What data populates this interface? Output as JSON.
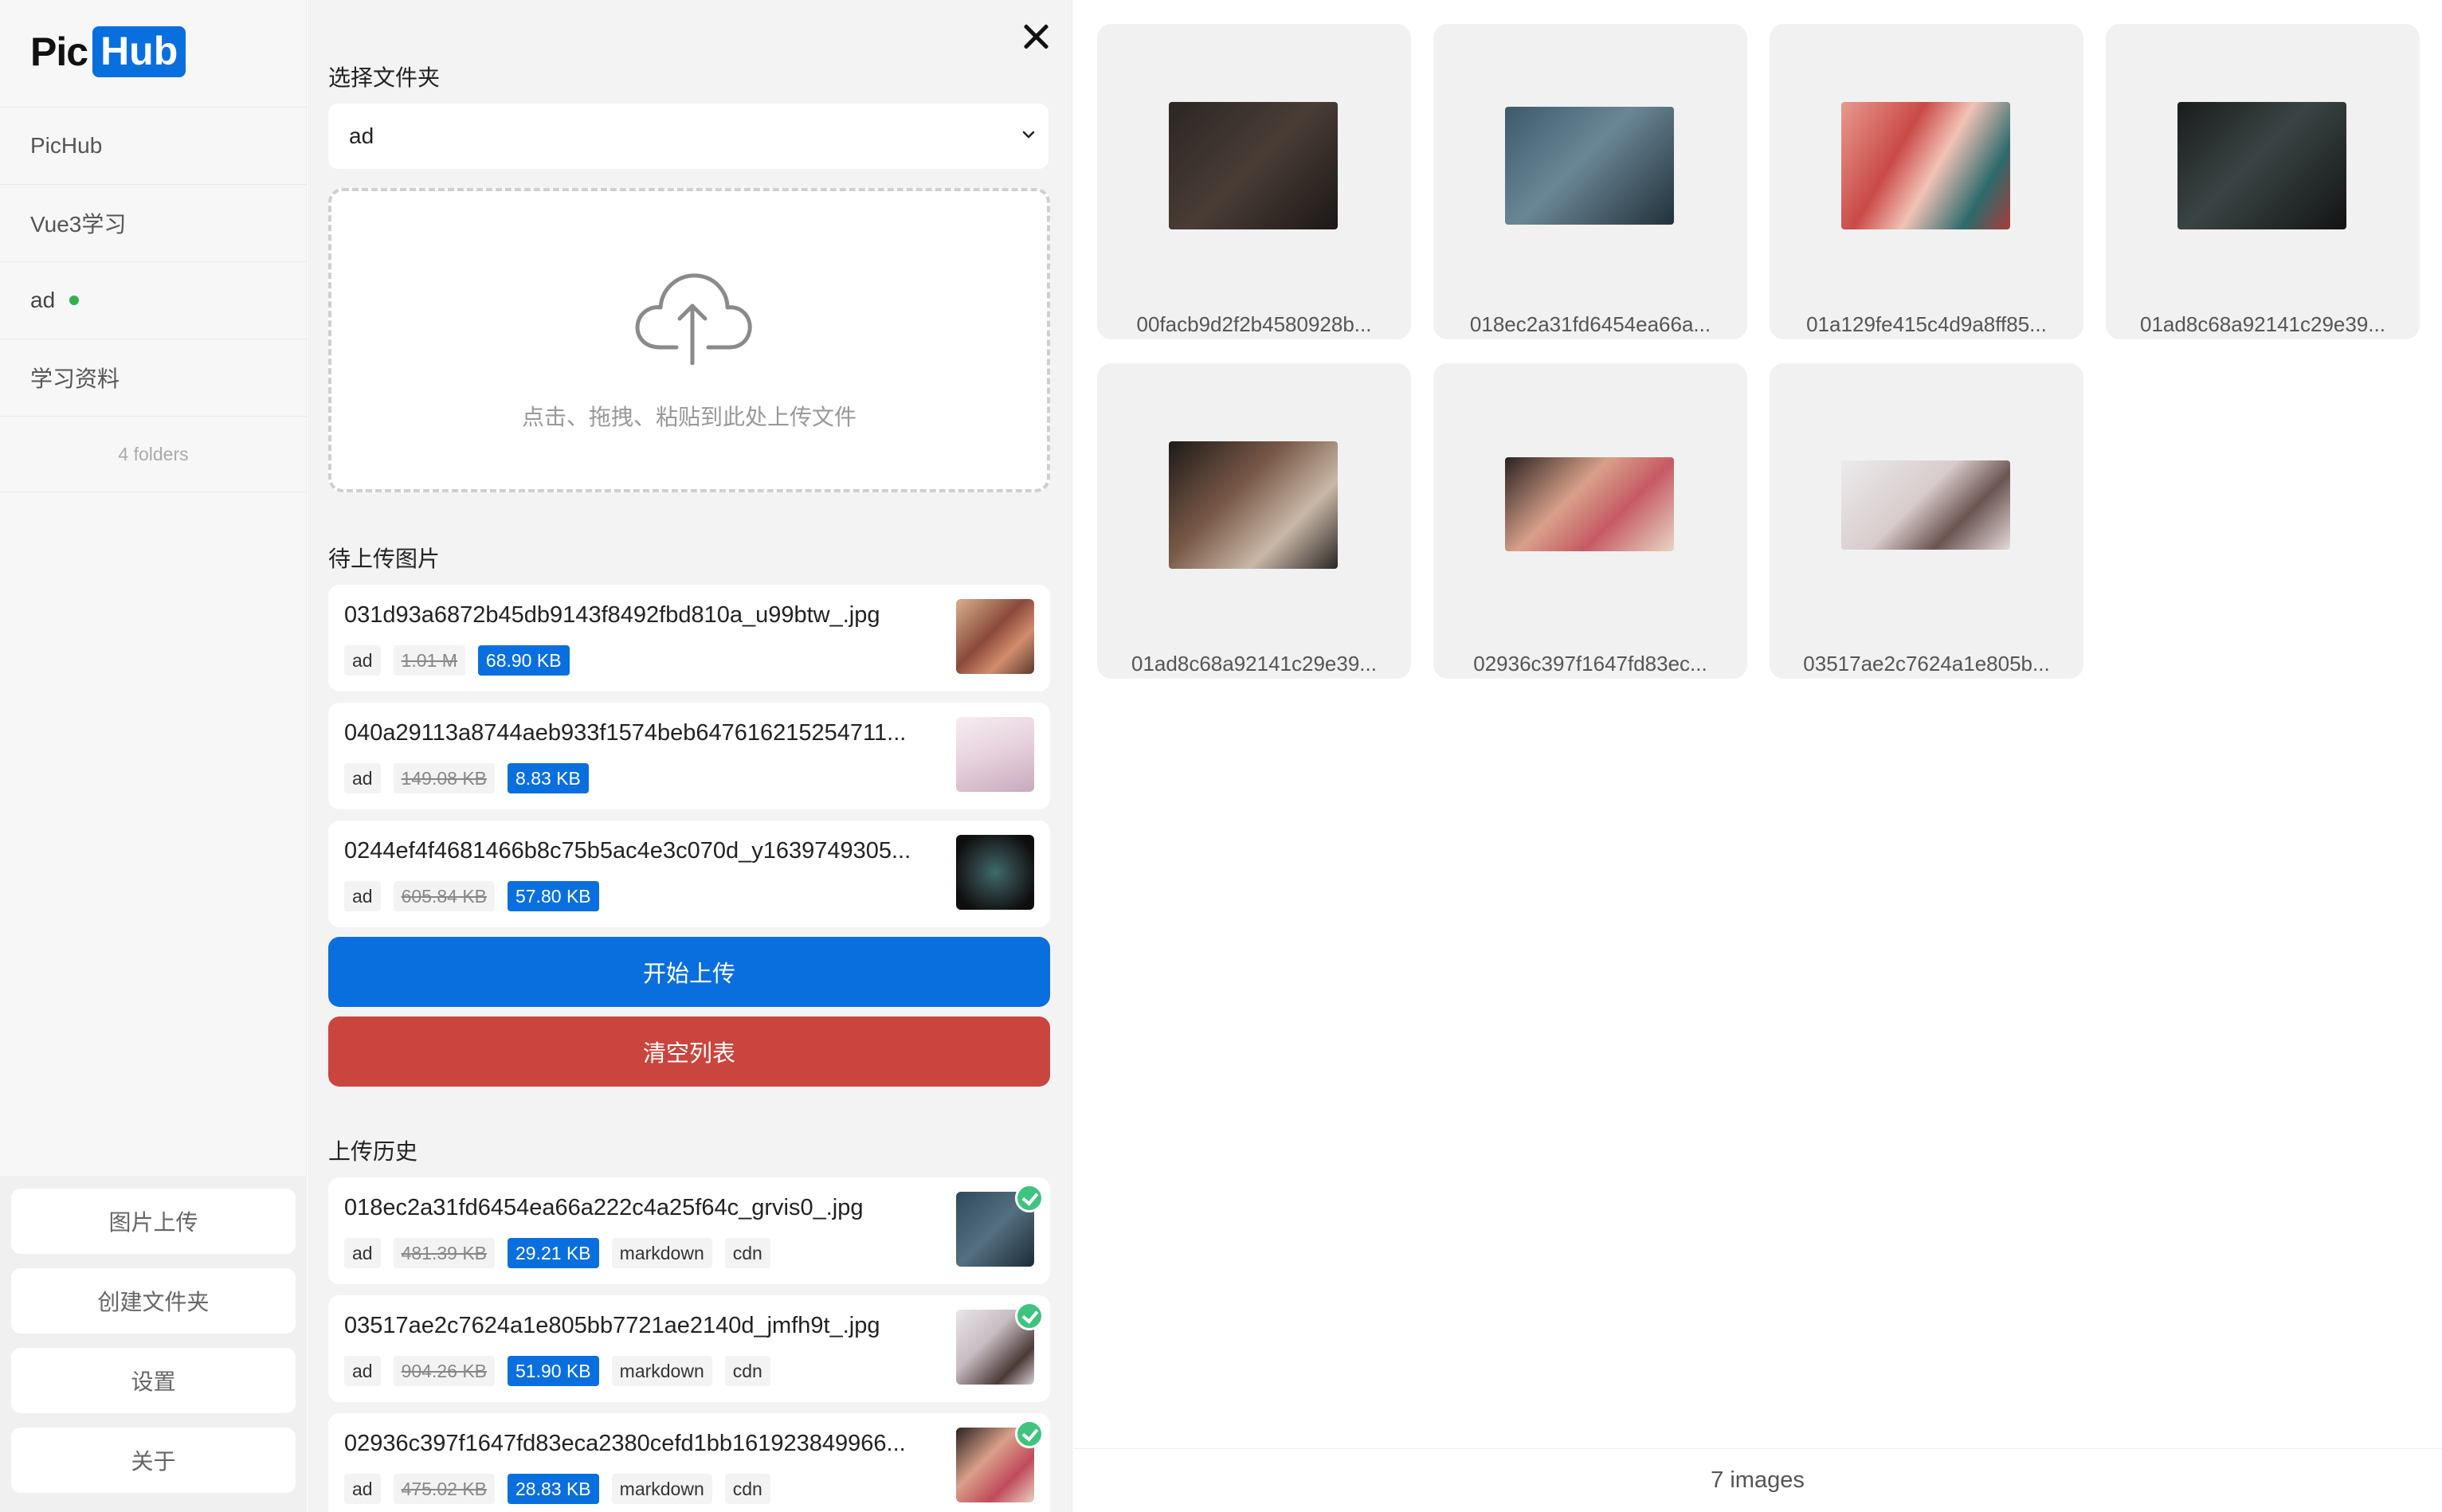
{
  "logo": {
    "part1": "Pic",
    "part2": "Hub"
  },
  "sidebar": {
    "folders": [
      {
        "label": "PicHub"
      },
      {
        "label": "Vue3学习"
      },
      {
        "label": "ad",
        "active": true
      },
      {
        "label": "学习资料"
      }
    ],
    "folder_count": "4 folders",
    "buttons": [
      {
        "label": "图片上传"
      },
      {
        "label": "创建文件夹"
      },
      {
        "label": "设置"
      },
      {
        "label": "关于"
      }
    ]
  },
  "panel": {
    "select_label": "选择文件夹",
    "selected_folder": "ad",
    "drop_text": "点击、拖拽、粘贴到此处上传文件",
    "pending_label": "待上传图片",
    "pending": [
      {
        "name": "031d93a6872b45db9143f8492fbd810a_u99btw_.jpg",
        "folder": "ad",
        "old_size": "1.01 M",
        "new_size": "68.90 KB"
      },
      {
        "name": "040a29113a8744aeb933f1574beb647616215254711...",
        "folder": "ad",
        "old_size": "149.08 KB",
        "new_size": "8.83 KB"
      },
      {
        "name": "0244ef4f4681466b8c75b5ac4e3c070d_y1639749305...",
        "folder": "ad",
        "old_size": "605.84 KB",
        "new_size": "57.80 KB"
      }
    ],
    "start_upload": "开始上传",
    "clear_list": "清空列表",
    "history_label": "上传历史",
    "history": [
      {
        "name": "018ec2a31fd6454ea66a222c4a25f64c_grvis0_.jpg",
        "folder": "ad",
        "old_size": "481.39 KB",
        "new_size": "29.21 KB",
        "tag1": "markdown",
        "tag2": "cdn"
      },
      {
        "name": "03517ae2c7624a1e805bb7721ae2140d_jmfh9t_.jpg",
        "folder": "ad",
        "old_size": "904.26 KB",
        "new_size": "51.90 KB",
        "tag1": "markdown",
        "tag2": "cdn"
      },
      {
        "name": "02936c397f1647fd83eca2380cefd1bb161923849966...",
        "folder": "ad",
        "old_size": "475.02 KB",
        "new_size": "28.83 KB",
        "tag1": "markdown",
        "tag2": "cdn"
      }
    ]
  },
  "gallery": {
    "images": [
      {
        "name": "00facb9d2f2b4580928b..."
      },
      {
        "name": "018ec2a31fd6454ea66a..."
      },
      {
        "name": "01a129fe415c4d9a8ff85..."
      },
      {
        "name": "01ad8c68a92141c29e39..."
      },
      {
        "name": "01ad8c68a92141c29e39..."
      },
      {
        "name": "02936c397f1647fd83ec..."
      },
      {
        "name": "03517ae2c7624a1e805b..."
      }
    ],
    "footer": "7 images"
  },
  "colors": {
    "accent": "#0a6fde",
    "danger": "#c9453d",
    "success": "#3ec47e",
    "active_dot": "#2fb24c"
  }
}
